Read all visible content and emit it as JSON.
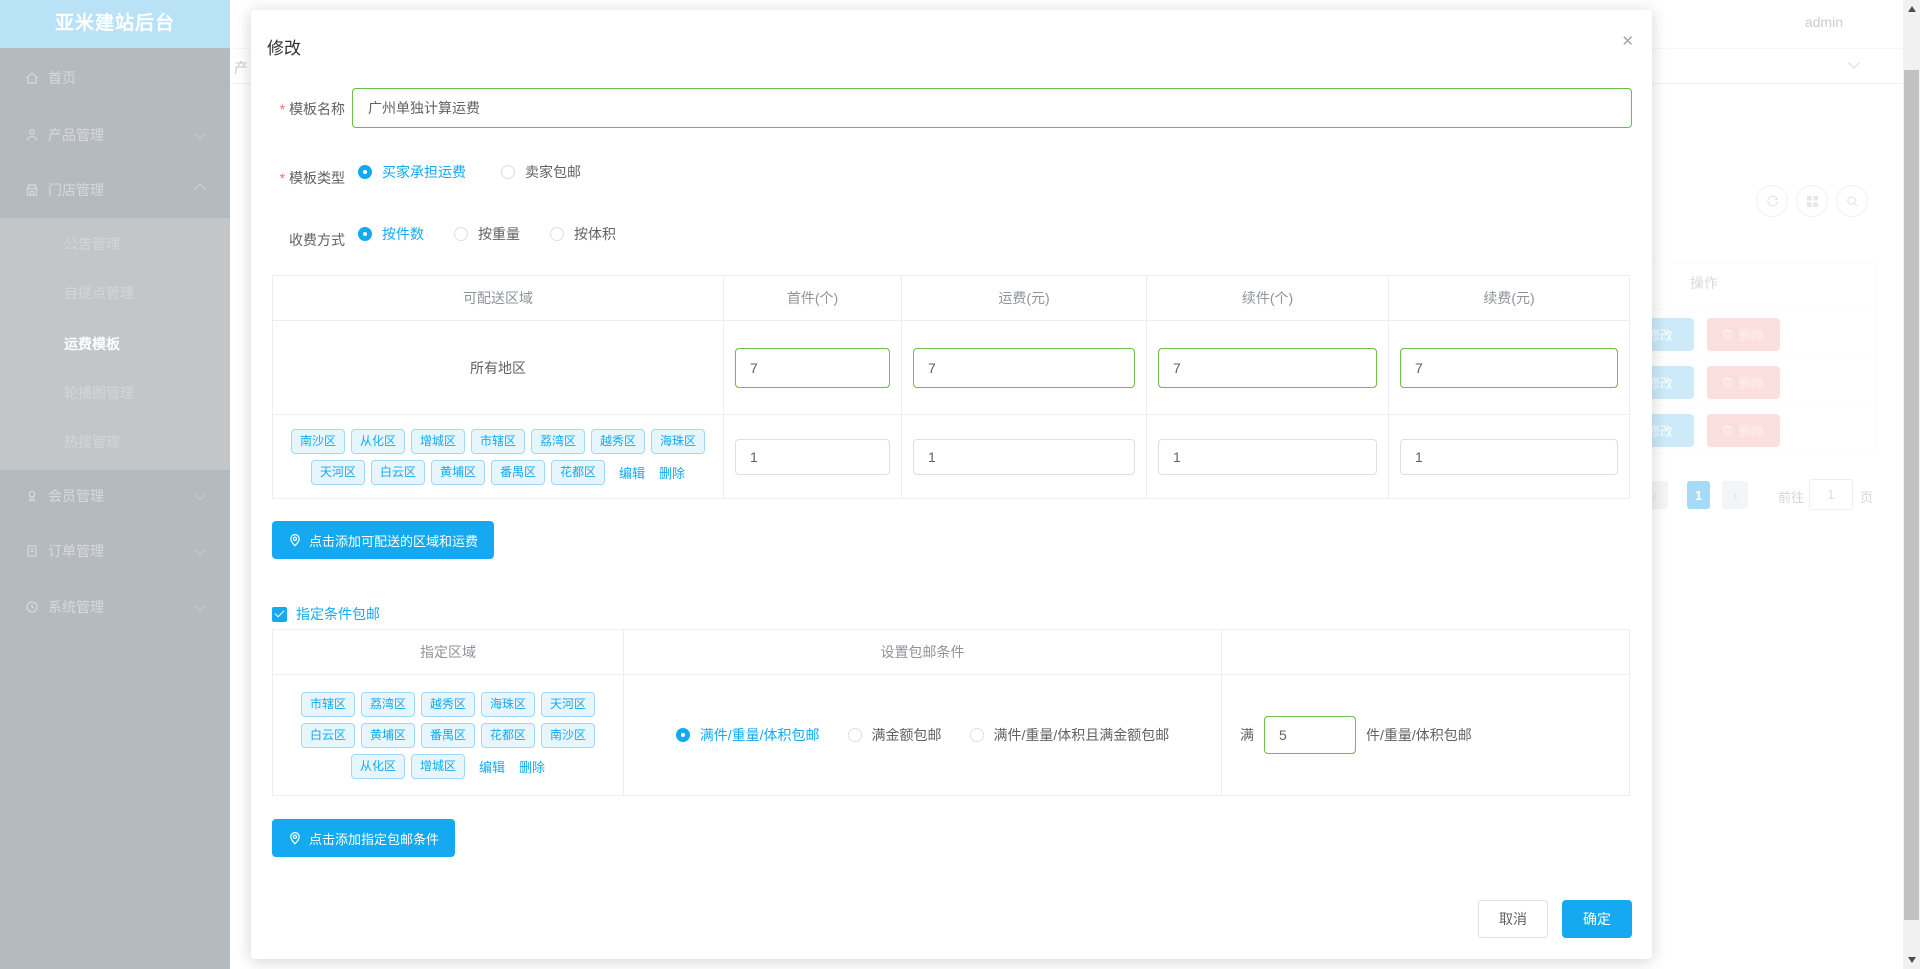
{
  "app": {
    "title": "亚米建站后台",
    "username": "admin"
  },
  "breadcrumb_partial": "产",
  "sidebar": {
    "items": [
      {
        "label": "首页"
      },
      {
        "label": "产品管理"
      },
      {
        "label": "门店管理"
      },
      {
        "label": "会员管理"
      },
      {
        "label": "订单管理"
      },
      {
        "label": "系统管理"
      }
    ],
    "submenu": [
      {
        "label": "公告管理"
      },
      {
        "label": "自提点管理"
      },
      {
        "label": "运费模板"
      },
      {
        "label": "轮播图管理"
      },
      {
        "label": "热搜管理"
      }
    ]
  },
  "background_list": {
    "ops_header": "操作",
    "edit_label": "修改",
    "delete_label": "删除",
    "pagination": {
      "prev": "‹",
      "current": "1",
      "next": "›",
      "goto_label": "前往",
      "goto_value": "1",
      "unit_label": "页"
    }
  },
  "modal": {
    "title": "修改",
    "close": "✕",
    "name_field": {
      "label": "模板名称",
      "value": "广州单独计算运费"
    },
    "type_field": {
      "label": "模板类型",
      "options": [
        {
          "label": "买家承担运费"
        },
        {
          "label": "卖家包邮"
        }
      ]
    },
    "charge_field": {
      "label": "收费方式",
      "options": [
        {
          "label": "按件数"
        },
        {
          "label": "按重量"
        },
        {
          "label": "按体积"
        }
      ]
    },
    "region_table": {
      "headers": [
        "可配送区域",
        "首件(个)",
        "运费(元)",
        "续件(个)",
        "续费(元)"
      ],
      "row_all": {
        "region": "所有地区",
        "first": "7",
        "fee": "7",
        "additional": "7",
        "additional_fee": "7"
      },
      "row_custom": {
        "tags_line1": [
          "南沙区",
          "从化区",
          "增城区",
          "市辖区",
          "荔湾区",
          "越秀区",
          "海珠区"
        ],
        "tags_line2": [
          "天河区",
          "白云区",
          "黄埔区",
          "番禺区",
          "花都区"
        ],
        "edit": "编辑",
        "delete": "删除",
        "first": "1",
        "fee": "1",
        "additional": "1",
        "additional_fee": "1"
      }
    },
    "add_region_label": "点击添加可配送的区域和运费",
    "free_condition_label": "指定条件包邮",
    "condition_table": {
      "headers": [
        "指定区域",
        "设置包邮条件"
      ],
      "tags_line1": [
        "市辖区",
        "荔湾区",
        "越秀区",
        "海珠区",
        "天河区"
      ],
      "tags_line2": [
        "白云区",
        "黄埔区",
        "番禺区",
        "花都区",
        "南沙区"
      ],
      "tags_line3": [
        "从化区",
        "增城区"
      ],
      "edit": "编辑",
      "delete": "删除",
      "options": [
        {
          "label": "满件/重量/体积包邮"
        },
        {
          "label": "满金额包邮"
        },
        {
          "label": "满件/重量/体积且满金额包邮"
        }
      ],
      "threshold": {
        "prefix": "满",
        "value": "5",
        "suffix": "件/重量/体积包邮"
      }
    },
    "add_condition_label": "点击添加指定包邮条件",
    "cancel_label": "取消",
    "confirm_label": "确定"
  },
  "colors": {
    "primary": "#14a9f1",
    "success_border": "#6abf44",
    "tag_bg": "#e7f6fd",
    "tag_border": "#9ed9f6"
  }
}
